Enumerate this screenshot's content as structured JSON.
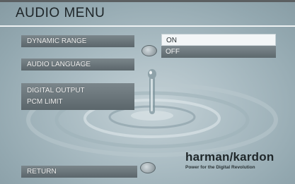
{
  "menu": {
    "title": "AUDIO MENU"
  },
  "items": {
    "dynamic_range": "DYNAMIC RANGE",
    "audio_language": "AUDIO LANGUAGE",
    "digital_output": "DIGITAL OUTPUT",
    "pcm_limit": "PCM LIMIT",
    "return": "RETURN"
  },
  "options": {
    "on": "ON",
    "off": "OFF"
  },
  "brand": {
    "name": "harman/kardon",
    "tagline": "Power for the Digital Revolution"
  },
  "colors": {
    "background": "#aabcc3",
    "button": "#6b767b",
    "selected_option": "#f3f6f7"
  }
}
